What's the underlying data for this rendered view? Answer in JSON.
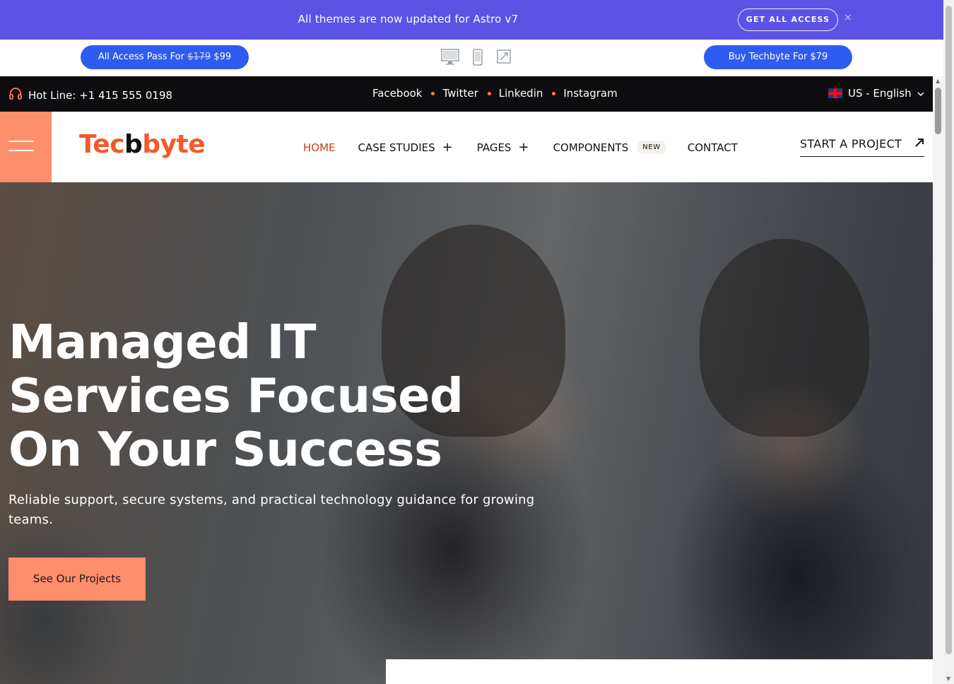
{
  "announcement": {
    "text": "All themes are now updated for Astro v7",
    "button_label": "GET ALL ACCESS",
    "close_glyph": "×",
    "background_color": "#5b53e6"
  },
  "preview_bar": {
    "pass_label_prefix": "All Access Pass For",
    "pass_old_price": "$179",
    "pass_new_price": "$99",
    "buy_label": "Buy Techbyte For $79",
    "device_icons": [
      "desktop-icon",
      "mobile-icon",
      "fullscreen-icon"
    ],
    "button_color": "#2f5cf0"
  },
  "infobar": {
    "hotline": "Hot Line: +1 415 555 0198",
    "socials": [
      "Facebook",
      "Twitter",
      "Linkedin",
      "Instagram"
    ],
    "language": "US - English",
    "accent_color": "#ff7a55"
  },
  "header": {
    "logo_part1": "Tec",
    "logo_part2": "b",
    "logo_part3": "byte",
    "nav": {
      "home": "HOME",
      "case_studies": "CASE STUDIES",
      "pages": "PAGES",
      "components": "COMPONENTS",
      "components_badge": "NEW",
      "contact": "CONTACT"
    },
    "cta": "START A PROJECT",
    "accent_color": "#fd8e6b"
  },
  "hero": {
    "title_line1": "Managed IT",
    "title_line2": "Services Focused",
    "title_line3": "On Your Success",
    "subtitle": "Reliable support, secure systems, and practical technology guidance for growing teams.",
    "cta": "See Our Projects"
  }
}
